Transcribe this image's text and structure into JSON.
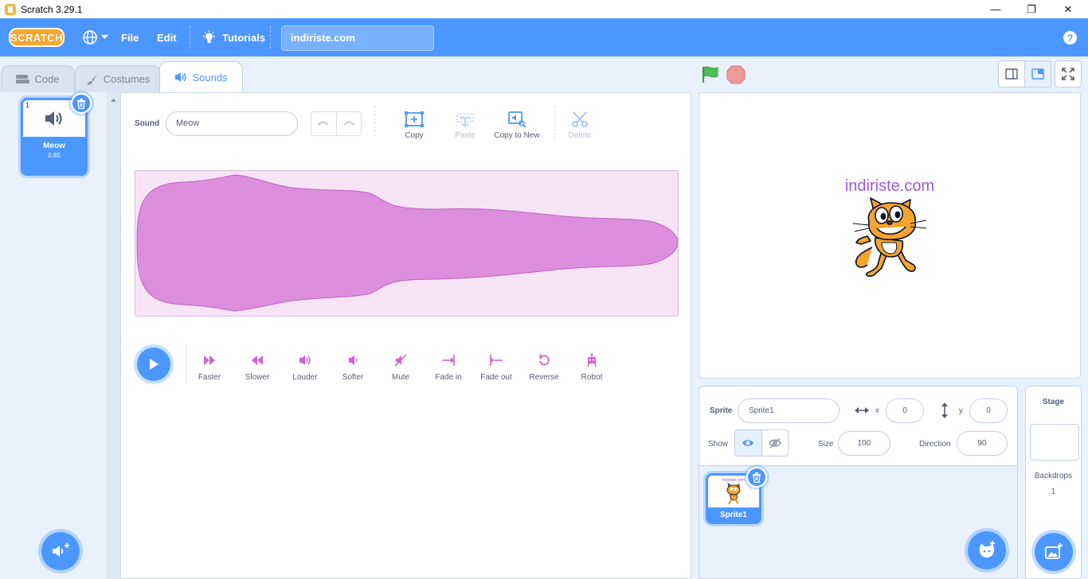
{
  "window": {
    "title": "Scratch 3.29.1",
    "minimize": "—",
    "restore": "❐",
    "close": "✕"
  },
  "menubar": {
    "logo": "SCRATCH",
    "file": "File",
    "edit": "Edit",
    "tutorials": "Tutorials",
    "project_title": "indiriste.com",
    "help": "?"
  },
  "tabs": [
    {
      "label": "Code"
    },
    {
      "label": "Costumes"
    },
    {
      "label": "Sounds"
    }
  ],
  "sound_list": {
    "items": [
      {
        "index": "1",
        "name": "Meow",
        "duration": "0.85"
      }
    ]
  },
  "editor": {
    "sound_label": "Sound",
    "sound_name": "Meow",
    "tools": {
      "copy": "Copy",
      "paste": "Paste",
      "copy_to_new": "Copy to New",
      "delete": "Delete"
    },
    "effects": [
      "Faster",
      "Slower",
      "Louder",
      "Softer",
      "Mute",
      "Fade in",
      "Fade out",
      "Reverse",
      "Robot"
    ],
    "waveform_color": "#dd8fde"
  },
  "stage": {
    "text": "indiriste.com"
  },
  "sprite_info": {
    "sprite_label": "Sprite",
    "sprite_name": "Sprite1",
    "x_label": "x",
    "x": "0",
    "y_label": "y",
    "y": "0",
    "show_label": "Show",
    "size_label": "Size",
    "size": "100",
    "direction_label": "Direction",
    "direction": "90"
  },
  "sprites": [
    {
      "name": "Sprite1",
      "thumb_text": "indiriste.com"
    }
  ],
  "stage_pane": {
    "header": "Stage",
    "backdrops_label": "Backdrops",
    "backdrops_count": "1"
  },
  "colors": {
    "primary": "#4c97ff",
    "menu_bar": "#4c97ff",
    "waveform_bg": "#f7e4f6",
    "text": "#575e75",
    "effect_icon": "#cf63cf",
    "stage_text": "#9d5ad8"
  }
}
